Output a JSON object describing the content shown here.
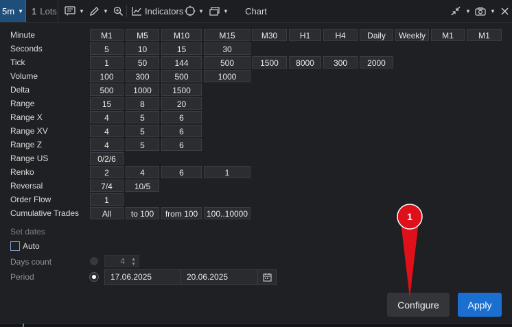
{
  "toolbar": {
    "timeframe": "5m",
    "lots_value": "1",
    "lots_unit": "Lots",
    "indicators_label": "Indicators",
    "title": "Chart"
  },
  "rows": [
    {
      "label": "Minute",
      "cells": [
        "M1",
        "M5",
        "M10",
        "M15",
        "M30",
        "H1",
        "H4",
        "Daily",
        "Weekly",
        "M1",
        "M1"
      ]
    },
    {
      "label": "Seconds",
      "cells": [
        "5",
        "10",
        "15",
        "30"
      ]
    },
    {
      "label": "Tick",
      "cells": [
        "1",
        "50",
        "144",
        "500",
        "1500",
        "8000",
        "300",
        "2000"
      ]
    },
    {
      "label": "Volume",
      "cells": [
        "100",
        "300",
        "500",
        "1000"
      ]
    },
    {
      "label": "Delta",
      "cells": [
        "500",
        "1000",
        "1500"
      ]
    },
    {
      "label": "Range",
      "cells": [
        "15",
        "8",
        "20"
      ]
    },
    {
      "label": "Range X",
      "cells": [
        "4",
        "5",
        "6"
      ]
    },
    {
      "label": "Range XV",
      "cells": [
        "4",
        "5",
        "6"
      ]
    },
    {
      "label": "Range Z",
      "cells": [
        "4",
        "5",
        "6"
      ]
    },
    {
      "label": "Range US",
      "cells": [
        "0/2/6"
      ]
    },
    {
      "label": "Renko",
      "cells": [
        "2",
        "4",
        "6",
        "1"
      ]
    },
    {
      "label": "Reversal",
      "cells": [
        "7/4",
        "10/5"
      ]
    },
    {
      "label": "Order Flow",
      "cells": [
        "1"
      ]
    },
    {
      "label": "Cumulative Trades",
      "cells": [
        "All",
        "to 100",
        "from 100",
        "100..10000"
      ]
    }
  ],
  "dates": {
    "section_label": "Set dates",
    "auto_label": "Auto",
    "auto_checked": false,
    "days_count_label": "Days count",
    "days_count_value": "4",
    "period_label": "Period",
    "period_from": "17.06.2025",
    "period_to": "20.06.2025"
  },
  "buttons": {
    "configure": "Configure",
    "apply": "Apply"
  },
  "annotation": {
    "marker_number": "1",
    "marker_color": "#e0101a"
  },
  "colors": {
    "accent": "#1b6fd1",
    "background": "#1f2024",
    "cell": "#2b2d31"
  }
}
